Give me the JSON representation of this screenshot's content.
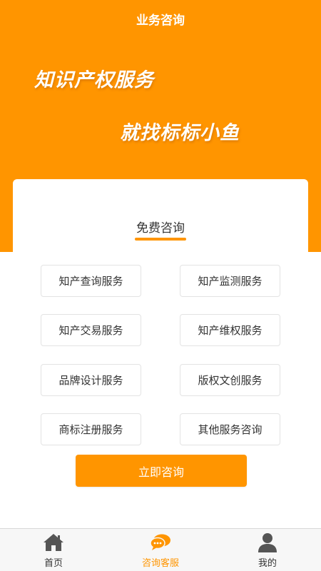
{
  "header": {
    "title": "业务咨询",
    "slogan_line1": "知识产权服务",
    "slogan_line2": "就找标标小鱼"
  },
  "consult_card": {
    "title": "免费咨询",
    "services": [
      "知产查询服务",
      "知产监测服务",
      "知产交易服务",
      "知产维权服务",
      "品牌设计服务",
      "版权文创服务",
      "商标注册服务",
      "其他服务咨询"
    ],
    "submit_label": "立即咨询"
  },
  "tabbar": {
    "items": [
      {
        "label": "首页",
        "icon": "home-icon",
        "active": false
      },
      {
        "label": "咨询客服",
        "icon": "chat-icon",
        "active": true
      },
      {
        "label": "我的",
        "icon": "user-icon",
        "active": false
      }
    ]
  },
  "colors": {
    "accent": "#ff9500",
    "text": "#333333",
    "border": "#e3e3e3",
    "tabbar_bg": "#f7f7f7",
    "icon_inactive": "#555555"
  }
}
